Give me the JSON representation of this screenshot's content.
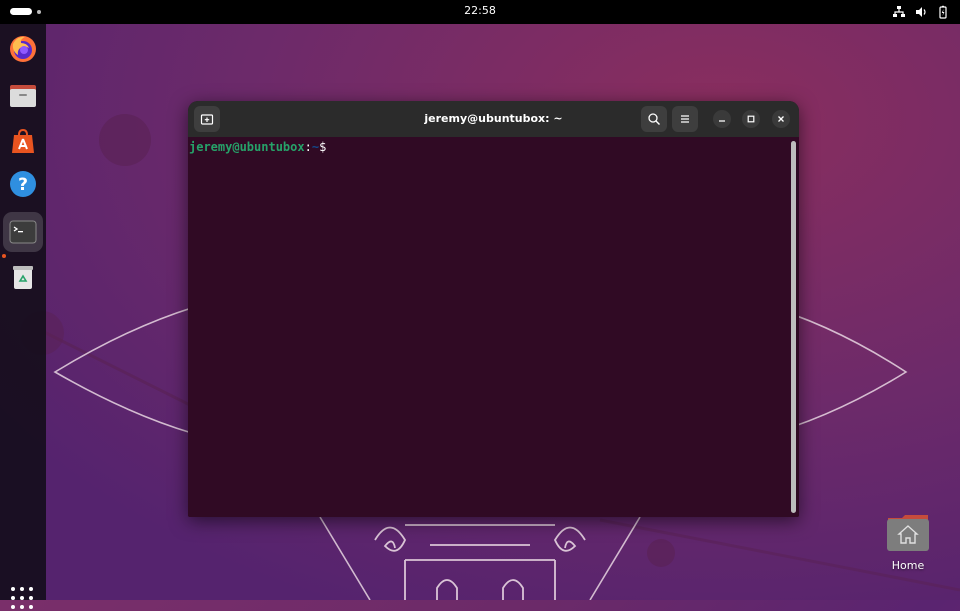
{
  "topbar": {
    "clock": "22:58",
    "tray_icons": [
      "network-icon",
      "volume-icon",
      "battery-icon"
    ]
  },
  "dock": {
    "items": [
      {
        "name": "Firefox",
        "icon": "firefox-icon"
      },
      {
        "name": "Files",
        "icon": "files-icon"
      },
      {
        "name": "App Center",
        "icon": "app-center-icon"
      },
      {
        "name": "Help",
        "icon": "help-icon"
      },
      {
        "name": "Terminal",
        "icon": "terminal-icon",
        "active": true
      },
      {
        "name": "Trash",
        "icon": "trash-icon"
      }
    ],
    "apps_icon": "show-apps-icon"
  },
  "terminal": {
    "title": "jeremy@ubuntubox: ~",
    "prompt_user": "jeremy@ubuntubox",
    "prompt_colon": ":",
    "prompt_path": "~",
    "prompt_symbol": "$",
    "colors": {
      "background": "#300a24",
      "user": "#26a269",
      "path": "#12488b",
      "headerbar": "#2b2b2b"
    }
  },
  "desktop": {
    "home_label": "Home"
  }
}
